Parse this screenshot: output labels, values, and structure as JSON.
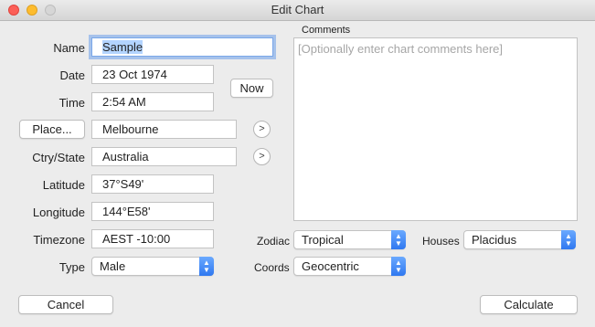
{
  "window": {
    "title": "Edit Chart"
  },
  "form": {
    "name": {
      "label": "Name",
      "value": "Sample"
    },
    "date": {
      "label": "Date",
      "value": "23 Oct 1974"
    },
    "time": {
      "label": "Time",
      "value": "2:54 AM"
    },
    "now_button": "Now",
    "place": {
      "button_label": "Place...",
      "value": "Melbourne"
    },
    "country": {
      "label": "Ctry/State",
      "value": "Australia"
    },
    "latitude": {
      "label": "Latitude",
      "value": "37°S49'"
    },
    "longitude": {
      "label": "Longitude",
      "value": "144°E58'"
    },
    "timezone": {
      "label": "Timezone",
      "value": "AEST -10:00"
    },
    "type": {
      "label": "Type",
      "value": "Male"
    }
  },
  "comments": {
    "label": "Comments",
    "placeholder": "[Optionally enter chart comments here]"
  },
  "options": {
    "zodiac": {
      "label": "Zodiac",
      "value": "Tropical"
    },
    "coords": {
      "label": "Coords",
      "value": "Geocentric"
    },
    "houses": {
      "label": "Houses",
      "value": "Placidus"
    }
  },
  "footer": {
    "cancel": "Cancel",
    "calculate": "Calculate"
  },
  "icons": {
    "go_arrow": ">"
  }
}
